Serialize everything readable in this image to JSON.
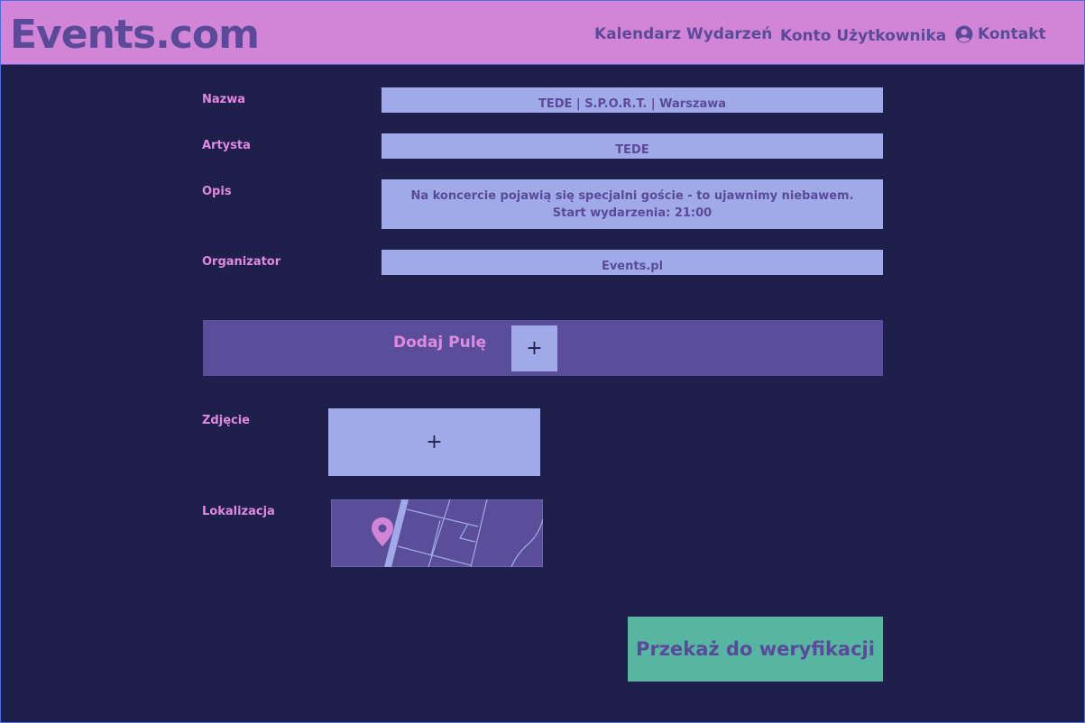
{
  "header": {
    "logo": "Events.com",
    "nav": {
      "calendar": "Kalendarz Wydarzeń",
      "account": "Konto Użytkownika",
      "contact": "Kontakt"
    }
  },
  "form": {
    "name": {
      "label": "Nazwa",
      "value": "TEDE | S.P.O.R.T. | Warszawa"
    },
    "artist": {
      "label": "Artysta",
      "value": "TEDE"
    },
    "description": {
      "label": "Opis",
      "line1": "Na koncercie pojawią się specjalni goście - to ujawnimy niebawem.",
      "line2": "Start wydarzenia: 21:00"
    },
    "organizer": {
      "label": "Organizator",
      "value": "Events.pl"
    },
    "pool": {
      "label": "Dodaj Pulę",
      "add_symbol": "+"
    },
    "photo": {
      "label": "Zdjęcie",
      "add_symbol": "+"
    },
    "location": {
      "label": "Lokalizacja",
      "pin_icon": "map-pin-icon"
    },
    "submit_label": "Przekaż do weryfikacji"
  },
  "colors": {
    "header_bg": "#d285d6",
    "page_bg": "#1f1f4b",
    "field_bg": "#a1aae8",
    "accent_text": "#5a4a99",
    "label_text": "#e089df",
    "submit_bg": "#56b6a2"
  }
}
